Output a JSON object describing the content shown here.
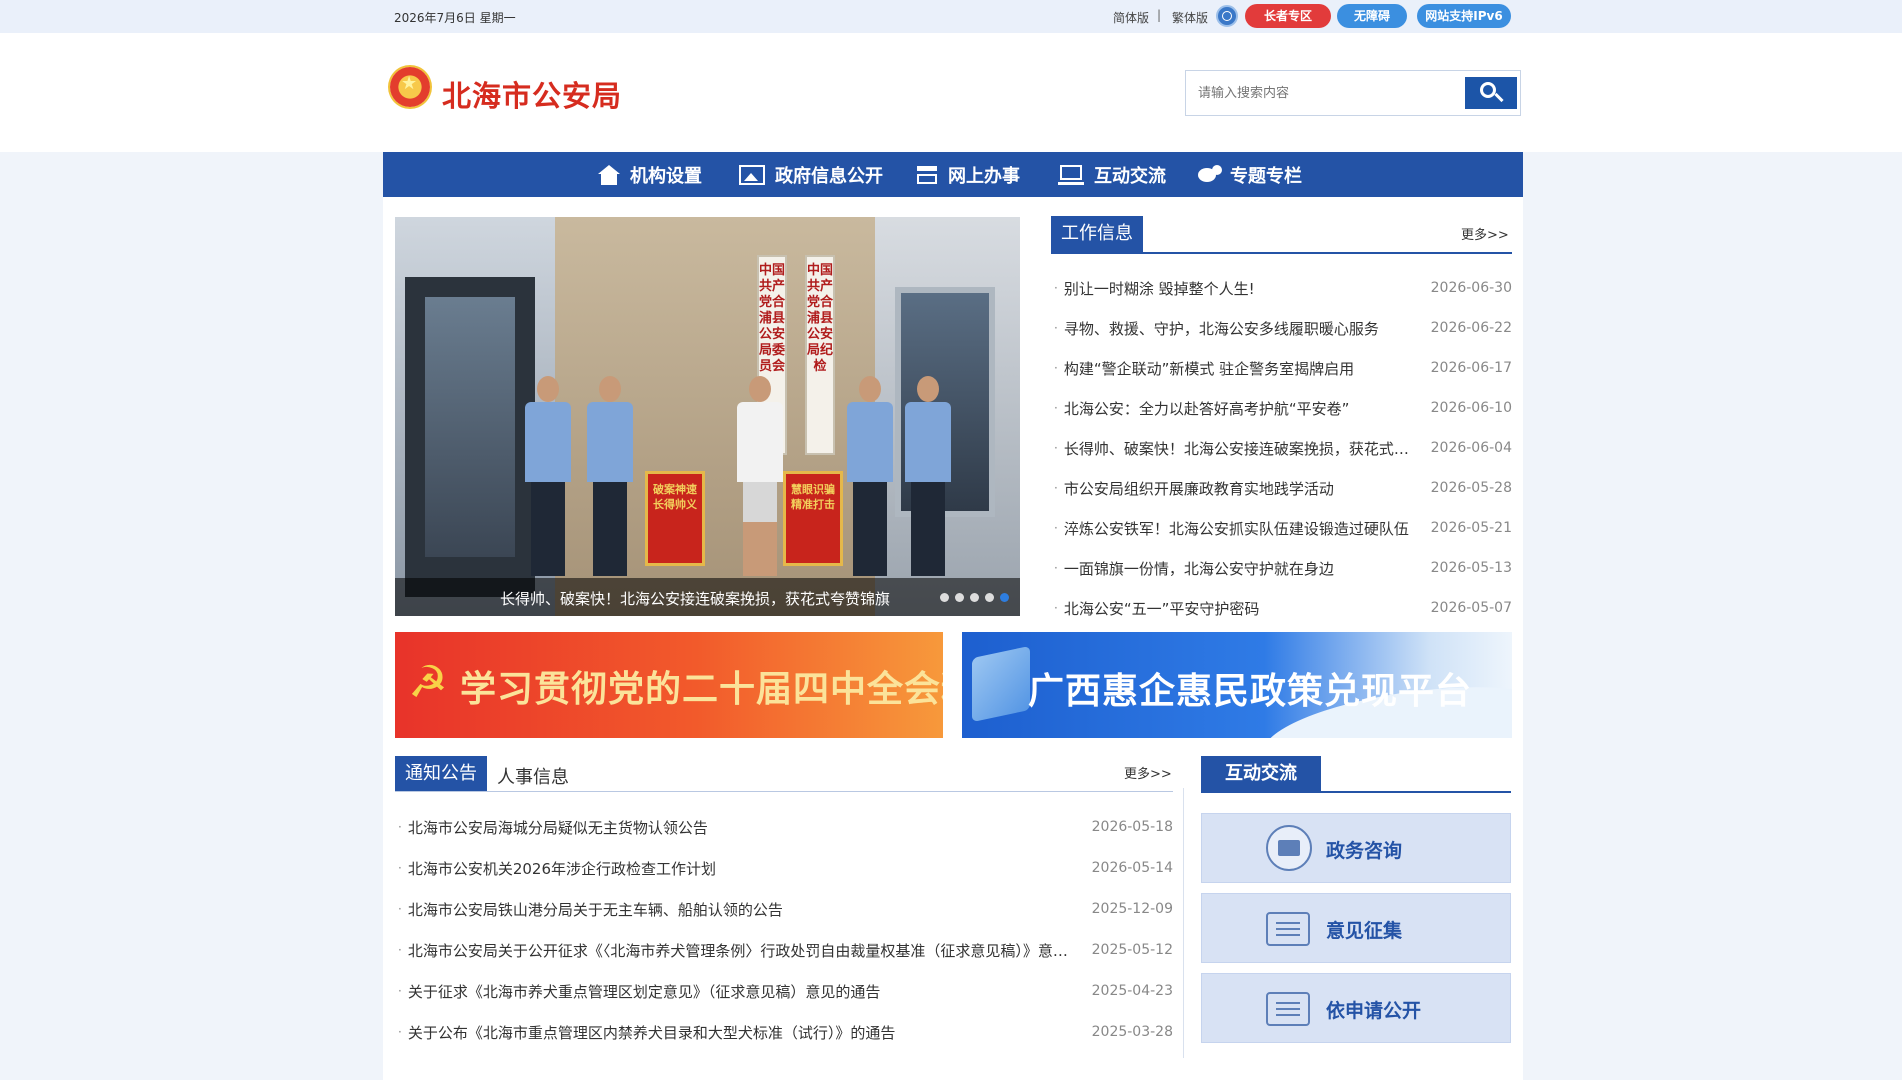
{
  "topbar": {
    "date": "2026年7月6日 星期一",
    "simplified": "简体版",
    "separator": "|",
    "traditional": "繁体版",
    "elder": "长者专区",
    "accessible": "无障碍",
    "ipv6": "网站支持IPv6"
  },
  "header": {
    "site_title": "北海市公安局",
    "search_placeholder": "请输入搜索内容"
  },
  "nav": [
    {
      "label": "机构设置",
      "icon": "home-icon"
    },
    {
      "label": "政府信息公开",
      "icon": "picture-icon"
    },
    {
      "label": "网上办事",
      "icon": "document-icon"
    },
    {
      "label": "互动交流",
      "icon": "computer-icon"
    },
    {
      "label": "专题专栏",
      "icon": "chat-icon"
    }
  ],
  "slider": {
    "caption": "长得帅、破案快！北海公安接连破案挽损，获花式夸赞锦旗",
    "plaque_left": "中国共产党合浦县公安局委员会",
    "plaque_right": "中国共产党合浦县公安局纪律检查委员会",
    "banner_left": "破案神速 长得帅义",
    "banner_right": "慧眼识骗 精准打击",
    "dots": 5,
    "active_dot": 5
  },
  "work_info": {
    "tab": "工作信息",
    "more": "更多>>",
    "items": [
      {
        "title": "别让一时糊涂 毁掉整个人生!",
        "date": "2026-06-30"
      },
      {
        "title": "寻物、救援、守护，北海公安多线履职暖心服务",
        "date": "2026-06-22"
      },
      {
        "title": "构建“警企联动”新模式 驻企警务室揭牌启用",
        "date": "2026-06-17"
      },
      {
        "title": "北海公安：全力以赴答好高考护航“平安卷”",
        "date": "2026-06-10"
      },
      {
        "title": "长得帅、破案快！北海公安接连破案挽损，获花式夸赞锦旗",
        "date": "2026-06-04"
      },
      {
        "title": "市公安局组织开展廉政教育实地践学活动",
        "date": "2026-05-28"
      },
      {
        "title": "淬炼公安铁军！北海公安抓实队伍建设锻造过硬队伍",
        "date": "2026-05-21"
      },
      {
        "title": "一面锦旗一份情，北海公安守护就在身边",
        "date": "2026-05-13"
      },
      {
        "title": "北海公安“五一”平安守护密码",
        "date": "2026-05-07"
      }
    ]
  },
  "promos": {
    "left": "学习贯彻党的二十届四中全会精神",
    "right": "广西惠企惠民政策兑现平台"
  },
  "notices": {
    "tab_active": "通知公告",
    "tab_other": "人事信息",
    "more": "更多>>",
    "items": [
      {
        "title": "北海市公安局海城分局疑似无主货物认领公告",
        "date": "2026-05-18"
      },
      {
        "title": "北海市公安机关2026年涉企行政检查工作计划",
        "date": "2026-05-14"
      },
      {
        "title": "北海市公安局铁山港分局关于无主车辆、船舶认领的公告",
        "date": "2025-12-09"
      },
      {
        "title": "北海市公安局关于公开征求《〈北海市养犬管理条例〉行政处罚自由裁量权基准（征求意见稿）》意见的公告",
        "date": "2025-05-12"
      },
      {
        "title": "关于征求《北海市养犬重点管理区划定意见》（征求意见稿）意见的通告",
        "date": "2025-04-23"
      },
      {
        "title": "关于公布《北海市重点管理区内禁养犬目录和大型犬标准（试行）》的通告",
        "date": "2025-03-28"
      }
    ]
  },
  "interaction": {
    "tab": "互动交流",
    "buttons": [
      {
        "label": "政务咨询",
        "icon": "mail-icon"
      },
      {
        "label": "意见征集",
        "icon": "message-icon"
      },
      {
        "label": "依申请公开",
        "icon": "message-icon"
      }
    ]
  },
  "colors": {
    "primary_blue": "#2453a6",
    "title_red": "#d62c1f",
    "elder_pill": "#e23b3b",
    "accessible_pill": "#3b8fe0",
    "ipv6_pill": "#3b8fe0"
  }
}
